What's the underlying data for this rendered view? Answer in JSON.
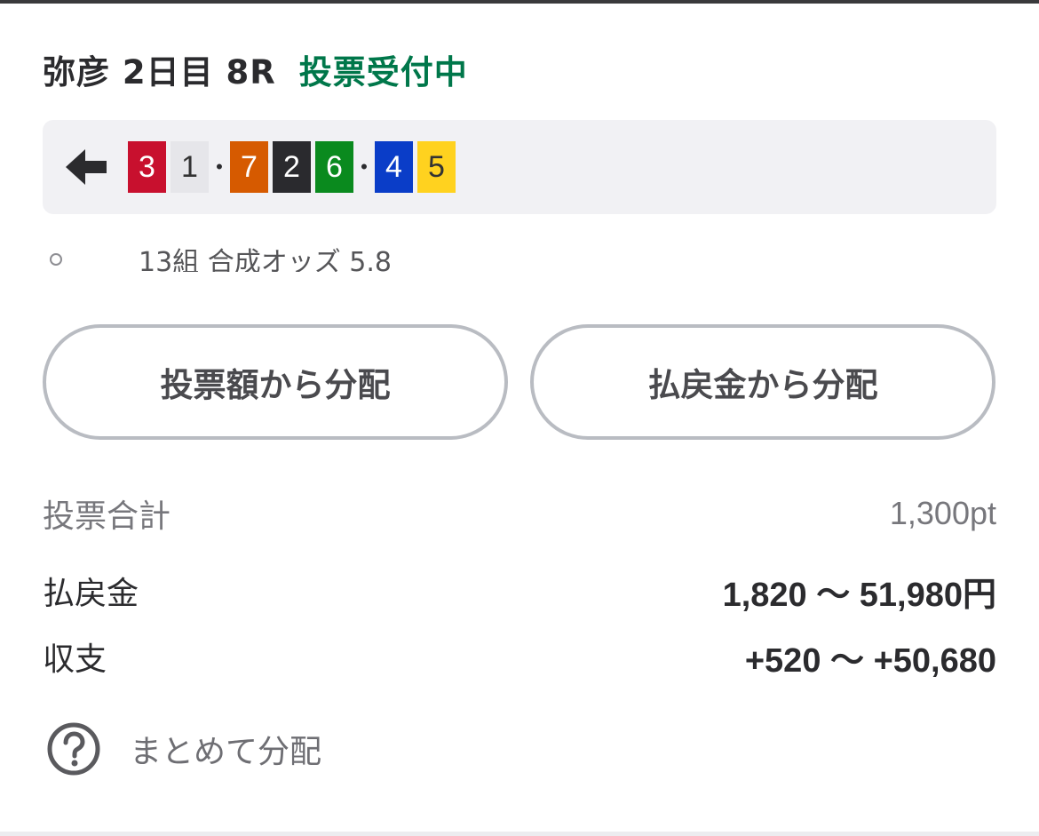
{
  "race": {
    "title": "弥彦 2日目 8R",
    "status": "投票受付中",
    "status_color": "#00774a"
  },
  "combo": {
    "back_icon": "back-arrow-icon",
    "groups": [
      [
        {
          "number": "3",
          "bg": "#c8102e",
          "fg": "#ffffff"
        },
        {
          "number": "1",
          "bg": "#e6e6ea",
          "fg": "#333333"
        }
      ],
      [
        {
          "number": "7",
          "bg": "#d65a00",
          "fg": "#ffffff"
        },
        {
          "number": "2",
          "bg": "#2a2a2e",
          "fg": "#ffffff"
        },
        {
          "number": "6",
          "bg": "#0a8a1e",
          "fg": "#ffffff"
        }
      ],
      [
        {
          "number": "4",
          "bg": "#0a3dc8",
          "fg": "#ffffff"
        },
        {
          "number": "5",
          "bg": "#ffd21f",
          "fg": "#333333"
        }
      ]
    ],
    "separator": "•"
  },
  "clipped_row": {
    "text": "13組 合成オッズ 5.8"
  },
  "buttons": {
    "by_bet_amount": "投票額から分配",
    "by_payout": "払戻金から分配"
  },
  "summary": {
    "total_label": "投票合計",
    "total_value": "1,300pt",
    "payout_label": "払戻金",
    "payout_value": "1,820 〜 51,980円",
    "balance_label": "収支",
    "balance_value": "+520 〜 +50,680"
  },
  "help": {
    "icon": "question-circle-icon",
    "label": "まとめて分配"
  }
}
